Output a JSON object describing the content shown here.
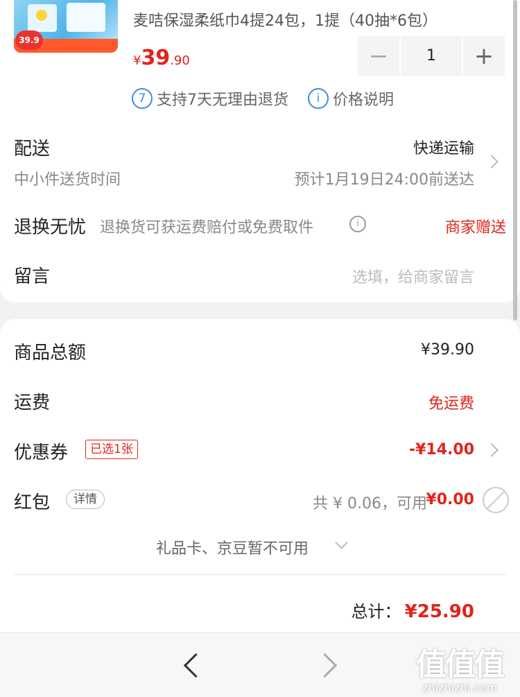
{
  "product": {
    "name": "麦咭保湿柔纸巾4提24包，1提（40抽*6包）",
    "thumb_price_badge": "39.9",
    "price_currency": "¥",
    "price_int": "39",
    "price_dec": ".90",
    "quantity": "1",
    "qty_minus": "−",
    "qty_plus": "+"
  },
  "services": [
    {
      "icon_text": "7",
      "label": "支持7天无理由退货"
    },
    {
      "icon_text": "i",
      "label": "价格说明"
    }
  ],
  "delivery": {
    "label": "配送",
    "method": "快递运输",
    "sub_label": "中小件送货时间",
    "eta": "预计1月19日24:00前送达"
  },
  "returns": {
    "label": "退换无忧",
    "desc": "退换货可获运费赔付或免费取件",
    "value": "商家赠送"
  },
  "message": {
    "label": "留言",
    "placeholder": "选填，给商家留言"
  },
  "summary": {
    "goods_total_label": "商品总额",
    "goods_total_value": "¥39.90",
    "shipping_label": "运费",
    "shipping_value": "免运费",
    "coupon_label": "优惠券",
    "coupon_tag": "已选1张",
    "coupon_value": "-¥14.00",
    "redpacket_label": "红包",
    "redpacket_tag": "详情",
    "redpacket_avail_prefix": "共 ¥ 0.06，可用",
    "redpacket_value": "¥0.00",
    "giftcard_text": "礼品卡、京豆暂不可用",
    "total_label": "总计：",
    "total_value": "¥25.90"
  },
  "watermark": {
    "logo": "值值值",
    "url": "zhizhizhi.com"
  },
  "colors": {
    "accent_red": "#e2231a",
    "info_blue": "#3b8de0"
  }
}
